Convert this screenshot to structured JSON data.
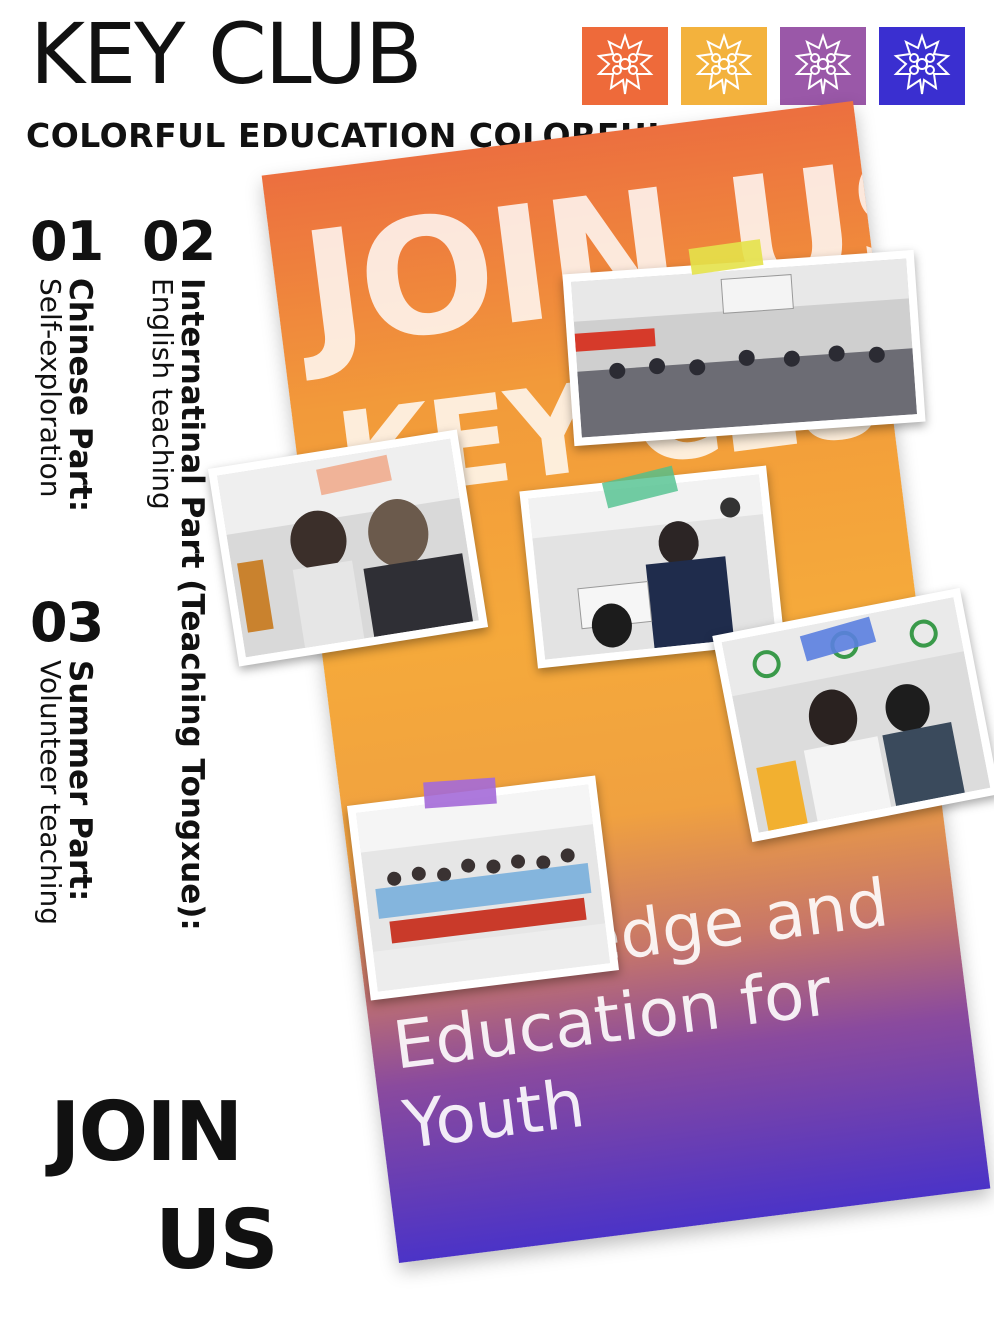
{
  "header": {
    "title": "KEY CLUB",
    "tagline": "COLORFUL EDUCATION COLORFUL LIFE",
    "logos": [
      {
        "name": "key-club-logo-orange",
        "color": "#ee6a3a"
      },
      {
        "name": "key-club-logo-yellow",
        "color": "#f3b23d"
      },
      {
        "name": "key-club-logo-purple",
        "color": "#9a58a8"
      },
      {
        "name": "key-club-logo-blue",
        "color": "#3a2fd0"
      }
    ]
  },
  "parts": [
    {
      "number": "01",
      "title": "Chinese Part:",
      "subtitle": "Self-exploration"
    },
    {
      "number": "02",
      "title": "Internatinal Part (Teaching Tongxue):",
      "subtitle": "English teaching"
    },
    {
      "number": "03",
      "title": "Summer Part:",
      "subtitle": "Volunteer teaching"
    }
  ],
  "cta": {
    "line1": "JOIN",
    "line2": "US"
  },
  "poster": {
    "line1": "JOIN US",
    "line2": "KEY CLUB",
    "slogan": [
      "Knowledge and",
      "Education for",
      "Youth"
    ],
    "gradient": [
      "#ec6f3f",
      "#f5a93b",
      "#4b33c7"
    ]
  },
  "photos": [
    {
      "name": "photo-classroom-presentation",
      "tape": "#e4e24a"
    },
    {
      "name": "photo-students-masks",
      "tape": "#f08a5d"
    },
    {
      "name": "photo-students-laptop",
      "tape": "#4fc08d"
    },
    {
      "name": "photo-teacher-children",
      "tape": "#5b7fe0"
    },
    {
      "name": "photo-group-banner",
      "tape": "#a46ad8"
    }
  ]
}
